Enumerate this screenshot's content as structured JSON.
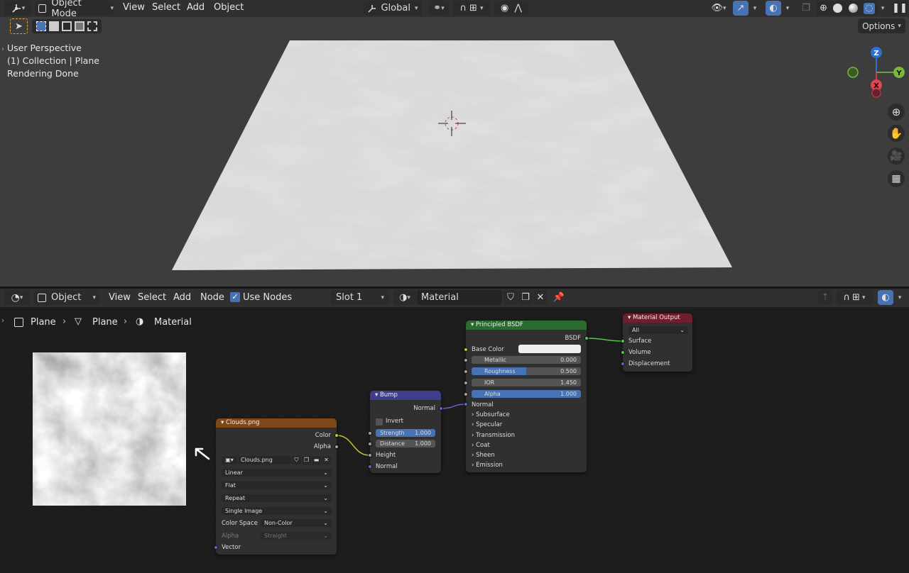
{
  "viewport": {
    "header": {
      "mode": "Object Mode",
      "menus": [
        "View",
        "Select",
        "Add",
        "Object"
      ],
      "transform_orientation": "Global",
      "options_label": "Options"
    },
    "overlay_text": [
      "User Perspective",
      "(1) Collection | Plane",
      "Rendering Done"
    ],
    "gizmo": {
      "z": "Z",
      "y": "Y",
      "x": "X"
    }
  },
  "node_editor": {
    "header": {
      "type": "Object",
      "menus": [
        "View",
        "Select",
        "Add",
        "Node"
      ],
      "use_nodes_label": "Use Nodes",
      "slot": "Slot 1",
      "material": "Material"
    },
    "breadcrumb": [
      "Plane",
      "Plane",
      "Material"
    ],
    "nodes": {
      "image": {
        "title": "Clouds.png",
        "outputs": [
          "Color",
          "Alpha"
        ],
        "image_name": "Clouds.png",
        "interpolation": "Linear",
        "projection": "Flat",
        "extension": "Repeat",
        "source": "Single Image",
        "color_space_label": "Color Space",
        "color_space": "Non-Color",
        "alpha_label": "Alpha",
        "alpha_mode": "Straight",
        "input": "Vector"
      },
      "bump": {
        "title": "Bump",
        "output": "Normal",
        "invert": "Invert",
        "strength_label": "Strength",
        "strength": "1.000",
        "distance_label": "Distance",
        "distance": "1.000",
        "inputs": [
          "Height",
          "Normal"
        ]
      },
      "bsdf": {
        "title": "Principled BSDF",
        "output": "BSDF",
        "base_color": "Base Color",
        "metallic_label": "Metallic",
        "metallic": "0.000",
        "roughness_label": "Roughness",
        "roughness": "0.500",
        "ior_label": "IOR",
        "ior": "1.450",
        "alpha_label": "Alpha",
        "alpha": "1.000",
        "normal": "Normal",
        "panels": [
          "Subsurface",
          "Specular",
          "Transmission",
          "Coat",
          "Sheen",
          "Emission"
        ]
      },
      "output": {
        "title": "Material Output",
        "target": "All",
        "inputs": [
          "Surface",
          "Volume",
          "Displacement"
        ]
      }
    }
  }
}
